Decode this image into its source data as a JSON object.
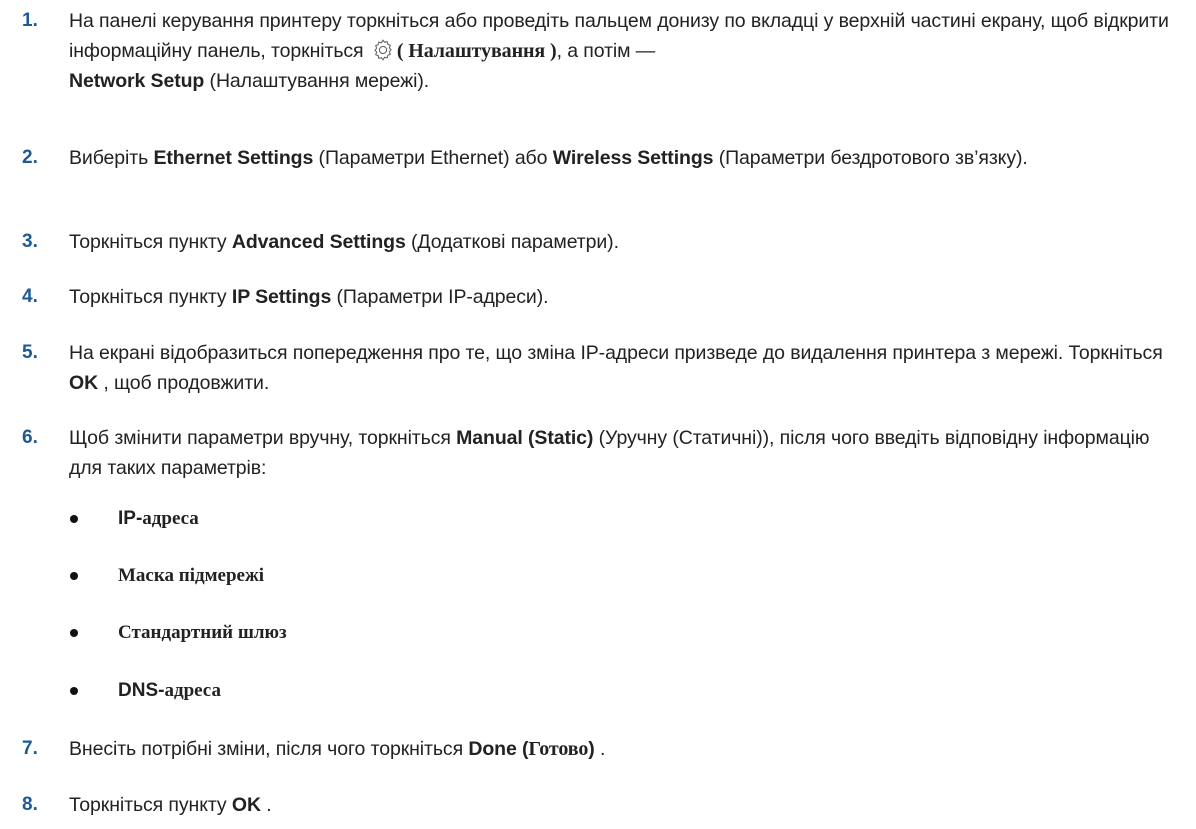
{
  "steps": [
    {
      "num": "1.",
      "t1": "На панелі керування принтеру торкніться або проведіть пальцем донизу по вкладці у верхній частині екрану, щоб відкрити інформаційну панель, торкніться ",
      "t2": "( Налаштування )",
      "t3": ", а потім —",
      "b1": "Network Setup",
      "t4": " (Налаштування мережі).",
      "icon": "gear-icon"
    },
    {
      "num": "2.",
      "t1": "Виберіть ",
      "b1": "Ethernet Settings",
      "t2": " (Параметри Ethernet) або ",
      "b2": "Wireless Settings",
      "t3": " (Параметри бездротового зв’язку)."
    },
    {
      "num": "3.",
      "t1": "Торкніться пункту ",
      "b1": "Advanced Settings",
      "t2": " (Додаткові параметри)."
    },
    {
      "num": "4.",
      "t1": "Торкніться пункту ",
      "b1": "IP Settings",
      "t2": " (Параметри IP-адреси)."
    },
    {
      "num": "5.",
      "t1": "На екрані відобразиться попередження про те, що зміна IP-адреси призведе до видалення принтера з мережі. Торкніться ",
      "b1": "OK",
      "t2": " , щоб продовжити."
    },
    {
      "num": "6.",
      "t1": "Щоб змінити параметри вручну, торкніться ",
      "b1": "Manual (Static)",
      "t2": " (Уручну (Статичні)), після чого введіть відповідну інформацію для таких параметрів:"
    },
    {
      "num": "7.",
      "t1": "Внесіть потрібні зміни, після чого торкніться ",
      "b1": "Done (",
      "b2": "Готово",
      "b3": ")",
      "t2": " ."
    },
    {
      "num": "8.",
      "t1": "Торкніться пункту ",
      "b1": "OK",
      "t2": " ."
    }
  ],
  "bullets": [
    {
      "sans": "IP-",
      "serif": "адреса"
    },
    {
      "sans": "",
      "serif": "Маска підмережі"
    },
    {
      "sans": "",
      "serif": "Стандартний шлюз"
    },
    {
      "sans": "DNS-",
      "serif": "адреса"
    }
  ],
  "colors": {
    "step_number": "#1d5a93",
    "text": "#222222"
  }
}
